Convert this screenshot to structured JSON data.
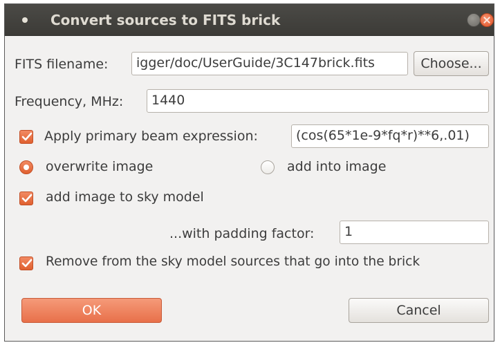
{
  "dialog": {
    "title": "Convert sources to FITS brick",
    "fits_filename_label": "FITS filename:",
    "fits_filename_value": "igger/doc/UserGuide/3C147brick.fits",
    "choose_label": "Choose...",
    "frequency_label": "Frequency, MHz:",
    "frequency_value": "1440",
    "apply_beam_label": "Apply primary beam expression:",
    "apply_beam_checked": true,
    "beam_expression_value": "(cos(65*1e-9*fq*r)**6,.01)",
    "overwrite_label": "overwrite image",
    "add_into_label": "add into image",
    "selected_mode": "overwrite image",
    "add_to_sky_label": "add image to sky model",
    "add_to_sky_checked": true,
    "padding_label": "...with padding factor:",
    "padding_value": "1",
    "remove_sources_label": "Remove from the sky model sources that go into the brick",
    "remove_sources_checked": true,
    "ok_label": "OK",
    "cancel_label": "Cancel"
  },
  "colors": {
    "accent": "#e8704a",
    "titlebar": "#3c3b37",
    "background": "#f2f1f0"
  }
}
